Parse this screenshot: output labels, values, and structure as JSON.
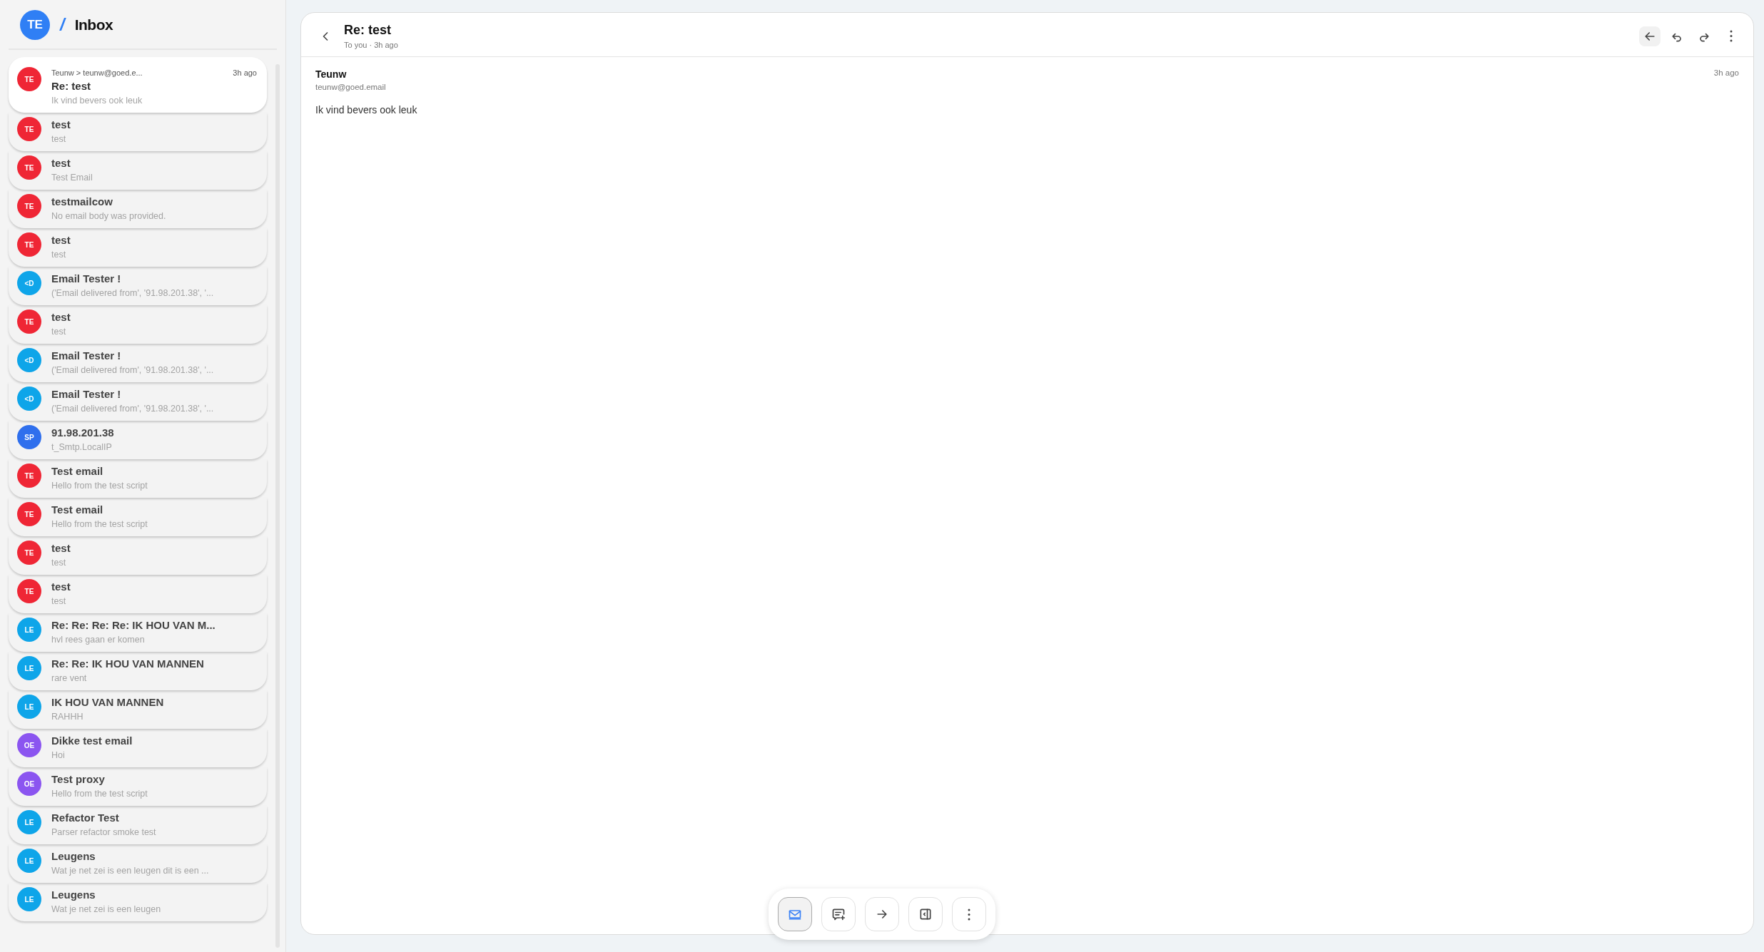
{
  "sidebar": {
    "account": {
      "initials": "TE"
    },
    "separator": "/",
    "title": "Inbox",
    "messages": [
      {
        "initials": "TE",
        "color": "#ef2635",
        "sender": "Teunw > teunw@goed.e...",
        "time": "3h ago",
        "subject": "Re: test",
        "preview": "Ik vind bevers ook leuk",
        "selected": true
      },
      {
        "initials": "TE",
        "color": "#ef2635",
        "subject": "test",
        "preview": "test",
        "selected": false
      },
      {
        "initials": "TE",
        "color": "#ef2635",
        "subject": "test",
        "preview": "Test Email",
        "selected": false
      },
      {
        "initials": "TE",
        "color": "#ef2635",
        "subject": "testmailcow",
        "preview": "No email body was provided.",
        "selected": false
      },
      {
        "initials": "TE",
        "color": "#ef2635",
        "subject": "test",
        "preview": "test",
        "selected": false
      },
      {
        "initials": "<D",
        "color": "#0ea5e9",
        "subject": "Email Tester !",
        "preview": "('Email delivered from', '91.98.201.38', '...",
        "selected": false
      },
      {
        "initials": "TE",
        "color": "#ef2635",
        "subject": "test",
        "preview": "test",
        "selected": false
      },
      {
        "initials": "<D",
        "color": "#0ea5e9",
        "subject": "Email Tester !",
        "preview": "('Email delivered from', '91.98.201.38', '...",
        "selected": false
      },
      {
        "initials": "<D",
        "color": "#0ea5e9",
        "subject": "Email Tester !",
        "preview": "('Email delivered from', '91.98.201.38', '...",
        "selected": false
      },
      {
        "initials": "SP",
        "color": "#2f6fed",
        "subject": "91.98.201.38",
        "preview": "t_Smtp.LocalIP",
        "selected": false
      },
      {
        "initials": "TE",
        "color": "#ef2635",
        "subject": "Test email",
        "preview": "Hello from the test script",
        "selected": false
      },
      {
        "initials": "TE",
        "color": "#ef2635",
        "subject": "Test email",
        "preview": "Hello from the test script",
        "selected": false
      },
      {
        "initials": "TE",
        "color": "#ef2635",
        "subject": "test",
        "preview": "test",
        "selected": false
      },
      {
        "initials": "TE",
        "color": "#ef2635",
        "subject": "test",
        "preview": "test",
        "selected": false
      },
      {
        "initials": "LE",
        "color": "#0ea5e9",
        "subject": "Re: Re: Re: Re: IK HOU VAN M...",
        "preview": "hvl rees gaan er komen",
        "selected": false
      },
      {
        "initials": "LE",
        "color": "#0ea5e9",
        "subject": "Re: Re: IK HOU VAN MANNEN",
        "preview": "rare vent",
        "selected": false
      },
      {
        "initials": "LE",
        "color": "#0ea5e9",
        "subject": "IK HOU VAN MANNEN",
        "preview": "RAHHH",
        "selected": false
      },
      {
        "initials": "OE",
        "color": "#8b55f0",
        "subject": "Dikke test email",
        "preview": "Hoi",
        "selected": false
      },
      {
        "initials": "OE",
        "color": "#8b55f0",
        "subject": "Test proxy",
        "preview": "Hello from the test script",
        "selected": false
      },
      {
        "initials": "LE",
        "color": "#0ea5e9",
        "subject": "Refactor Test",
        "preview": "Parser refactor smoke test",
        "selected": false
      },
      {
        "initials": "LE",
        "color": "#0ea5e9",
        "subject": "Leugens",
        "preview": "Wat je net zei is een leugen dit is een ...",
        "selected": false
      },
      {
        "initials": "LE",
        "color": "#0ea5e9",
        "subject": "Leugens",
        "preview": "Wat je net zei is een leugen",
        "selected": false
      }
    ]
  },
  "message": {
    "title": "Re: test",
    "meta": "To you · 3h ago",
    "header_actions": [
      {
        "kind": "back",
        "selected": true
      },
      {
        "kind": "reply",
        "selected": false
      },
      {
        "kind": "forward",
        "selected": false
      },
      {
        "kind": "more",
        "selected": false
      }
    ],
    "from_name": "Teunw",
    "from_email": "teunw@goed.email",
    "time": "3h ago",
    "body": "Ik vind bevers ook leuk"
  },
  "toolbar": [
    {
      "kind": "mail",
      "selected": true
    },
    {
      "kind": "comment-add",
      "selected": false
    },
    {
      "kind": "arrow",
      "selected": false
    },
    {
      "kind": "panel",
      "selected": false
    },
    {
      "kind": "more",
      "selected": false
    }
  ]
}
